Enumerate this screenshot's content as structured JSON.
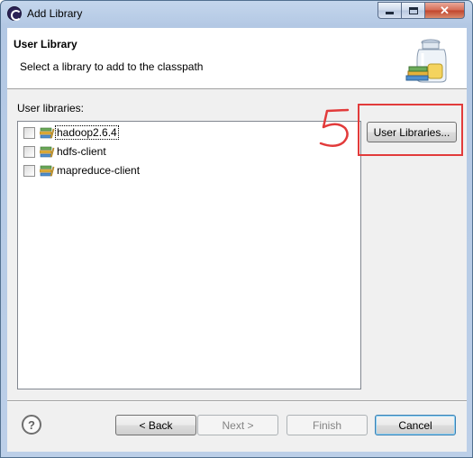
{
  "window": {
    "title": "Add Library",
    "controls": {
      "minimize": "",
      "maximize": "",
      "close": "✕"
    }
  },
  "header": {
    "title": "User Library",
    "description": "Select a library to add to the classpath"
  },
  "libraries": {
    "label": "User libraries:",
    "items": [
      {
        "label": "hadoop2.6.4",
        "checked": false,
        "focused": true
      },
      {
        "label": "hdfs-client",
        "checked": false,
        "focused": false
      },
      {
        "label": "mapreduce-client",
        "checked": false,
        "focused": false
      }
    ]
  },
  "user_libraries_button": "User Libraries...",
  "annotation": {
    "text": "5",
    "color": "#e23b3b"
  },
  "footer": {
    "help": "?",
    "back": "< Back",
    "next": "Next >",
    "finish": "Finish",
    "cancel": "Cancel"
  },
  "icons": {
    "app": "eclipse-icon",
    "banner": "library-jar-icon",
    "library": "library-books-icon",
    "help": "help-icon"
  }
}
